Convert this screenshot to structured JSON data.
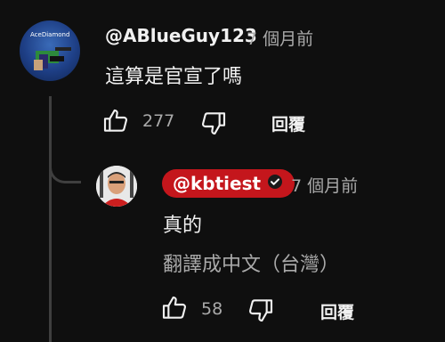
{
  "comment": {
    "author": "@ABlueGuy123",
    "time": "7 個月前",
    "text": "這算是官宣了嗎",
    "likes": "277",
    "reply_label": "回覆",
    "avatar_text": "AceDiamond"
  },
  "reply": {
    "author": "@kbtiest",
    "verified_icon": "verified-check-icon",
    "time": "7 個月前",
    "text": "真的",
    "translate_label": "翻譯成中文（台灣）",
    "likes": "58",
    "reply_label": "回覆"
  },
  "colors": {
    "background": "#0f0f0f",
    "badge": "#c4161c",
    "secondary_text": "#aaaaaa"
  }
}
